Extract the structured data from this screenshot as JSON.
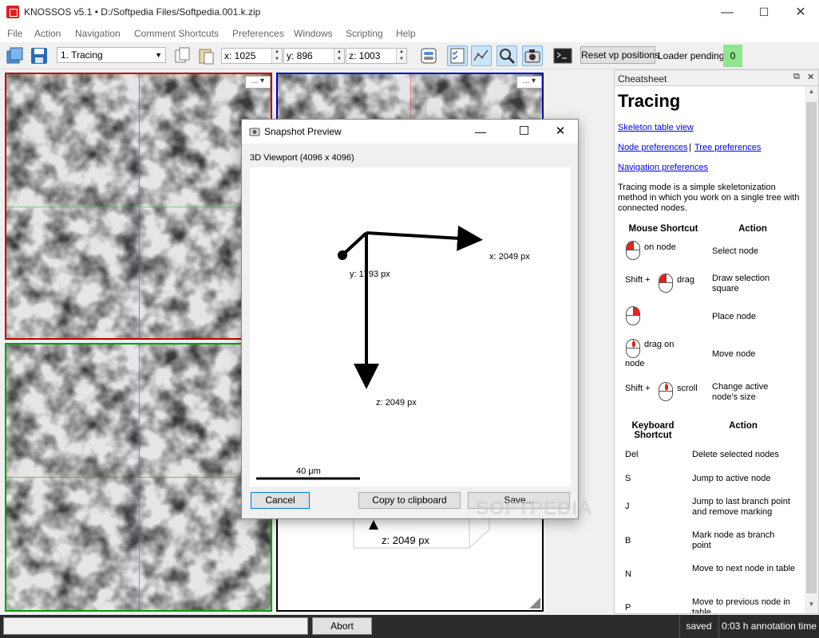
{
  "window": {
    "title": "KNOSSOS v5.1 • D:/Softpedia Files/Softpedia.001.k.zip",
    "minimize": "—",
    "maximize": "☐",
    "close": "✕"
  },
  "menu": [
    "File",
    "Action",
    "Navigation",
    "Comment Shortcuts",
    "Preferences",
    "Windows",
    "Scripting",
    "Help"
  ],
  "toolbar": {
    "mode": "1. Tracing",
    "x": "x: 1025",
    "y": "y: 896",
    "z": "z: 1003",
    "reset_vp": "Reset vp positions",
    "loader_label": "Loader pending:",
    "loader_count": "0",
    "loader_color": "#8fe68f"
  },
  "viewports": {
    "menu_label": "... ▾",
    "cube_label": "z: 2049 px",
    "colors": {
      "xy": "#c00000",
      "xz": "#00a000",
      "zy": "#0000c0"
    }
  },
  "dock": {
    "title": "Cheatsheet",
    "float": "⧉",
    "close": "✕",
    "heading": "Tracing",
    "links": {
      "skeleton": "Skeleton table view",
      "node": "Node preferences",
      "sep": "|",
      "tree": "Tree preferences",
      "nav": "Navigation preferences"
    },
    "intro": "Tracing mode is a simple skeletonization method in which you work on a single tree with connected nodes.",
    "mouse_header": "Mouse Shortcut",
    "action_header": "Action",
    "mouse_rows": [
      {
        "pre": "",
        "post": "on node",
        "post2": "",
        "action": "Select node",
        "icon": "left"
      },
      {
        "pre": "Shift +",
        "post": "drag",
        "post2": "",
        "action": "Draw selection square",
        "icon": "left"
      },
      {
        "pre": "",
        "post": "",
        "post2": "",
        "action": "Place node",
        "icon": "right"
      },
      {
        "pre": "",
        "post": "drag on",
        "post2": "node",
        "action": "Move node",
        "icon": "mid"
      },
      {
        "pre": "Shift +",
        "post": "scroll",
        "post2": "",
        "action": "Change active node's size",
        "icon": "mid"
      }
    ],
    "kb_header": "Keyboard Shortcut",
    "kb_action_header": "Action",
    "kb_rows": [
      {
        "key": "Del",
        "action": "Delete selected nodes"
      },
      {
        "key": "S",
        "action": "Jump to active node"
      },
      {
        "key": "J",
        "action": "Jump to last branch point and remove marking"
      },
      {
        "key": "B",
        "action": "Mark node as branch point"
      },
      {
        "key": "N",
        "action": "Move to next node in table"
      },
      {
        "key": "P",
        "action": "Move to previous node in table"
      }
    ]
  },
  "dialog": {
    "title": "Snapshot Preview",
    "subtitle": "3D Viewport (4096 x 4096)",
    "x_label": "x: 2049 px",
    "y_label": "y: 1793 px",
    "z_label": "z: 2049 px",
    "scale_label": "40 μm",
    "cancel": "Cancel",
    "copy": "Copy to clipboard",
    "save": "Save..."
  },
  "status": {
    "abort": "Abort",
    "saved": "saved",
    "time": "0:03 h annotation time"
  },
  "watermark": "SOFTPEDIA"
}
